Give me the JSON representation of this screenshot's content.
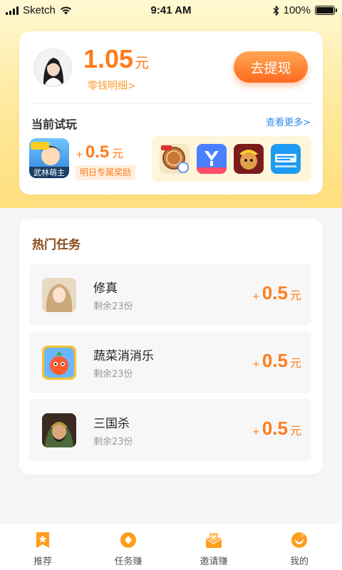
{
  "status_bar": {
    "carrier": "Sketch",
    "time": "9:41 AM",
    "battery": "100%"
  },
  "wallet": {
    "balance": "1.05",
    "unit": "元",
    "detail_link": "零钱明细>",
    "withdraw_label": "去提现"
  },
  "current_trial": {
    "title": "当前试玩",
    "see_more": "查看更多>",
    "game_name": "武林萌主",
    "game_logo_text": "武林萌主",
    "plus": "+",
    "reward": "0.5",
    "unit": "元",
    "badge": "明日专属奖励",
    "more_games": [
      {
        "icon": "chess-game-icon"
      },
      {
        "icon": "y-app-icon"
      },
      {
        "icon": "monkey-game-icon"
      },
      {
        "icon": "finance-app-icon"
      }
    ]
  },
  "hot_tasks": {
    "title": "热门任务",
    "items": [
      {
        "name": "修真",
        "remaining": "剩余23份",
        "plus": "+",
        "reward": "0.5",
        "unit": "元",
        "icon": "xiuzhen-game-icon"
      },
      {
        "name": "蔬菜消消乐",
        "remaining": "剩余23份",
        "plus": "+",
        "reward": "0.5",
        "unit": "元",
        "icon": "vegetable-game-icon"
      },
      {
        "name": "三国杀",
        "remaining": "剩余23份",
        "plus": "+",
        "reward": "0.5",
        "unit": "元",
        "icon": "sanguosha-game-icon"
      }
    ]
  },
  "tab_bar": {
    "items": [
      {
        "label": "推荐",
        "icon": "star-bookmark-icon"
      },
      {
        "label": "任务赚",
        "icon": "coin-icon"
      },
      {
        "label": "邀请赚",
        "icon": "envelope-icon"
      },
      {
        "label": "我的",
        "icon": "profile-icon"
      }
    ]
  },
  "colors": {
    "accent": "#ff7c1b",
    "link": "#2d8ae8",
    "tab_icon": "#ff9d1c"
  }
}
